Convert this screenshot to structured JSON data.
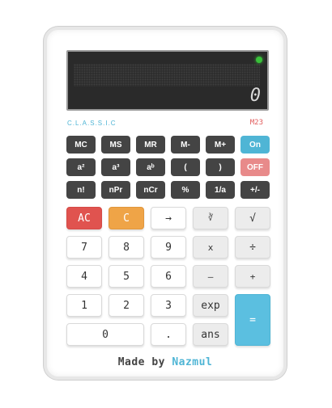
{
  "display": {
    "value": "0"
  },
  "brand": "C.L.A.S.S.I.C",
  "model": "M23",
  "rows": {
    "memory": [
      "MC",
      "MS",
      "MR",
      "M-",
      "M+",
      "On"
    ],
    "powers": [
      "a²",
      "a³",
      "aᵇ",
      "(",
      ")",
      "OFF"
    ],
    "functions": [
      "n!",
      "nPr",
      "nCr",
      "%",
      "1/a",
      "+/-"
    ],
    "control": [
      "AC",
      "C",
      "→",
      "∛",
      "√"
    ],
    "row7": [
      "7",
      "8",
      "9",
      "x",
      "÷"
    ],
    "row4": [
      "4",
      "5",
      "6",
      "–",
      "+"
    ],
    "row1": [
      "1",
      "2",
      "3",
      "exp",
      "="
    ],
    "row0": [
      "0",
      ".",
      "ans"
    ]
  },
  "credit": {
    "prefix": "Made by ",
    "author": "Nazmul"
  },
  "colors": {
    "accent_blue": "#4fb5d5",
    "off_red": "#e88a8a",
    "ac_red": "#e0534f",
    "c_orange": "#efa447",
    "led_green": "#39c13a",
    "dark_key": "#444444"
  }
}
